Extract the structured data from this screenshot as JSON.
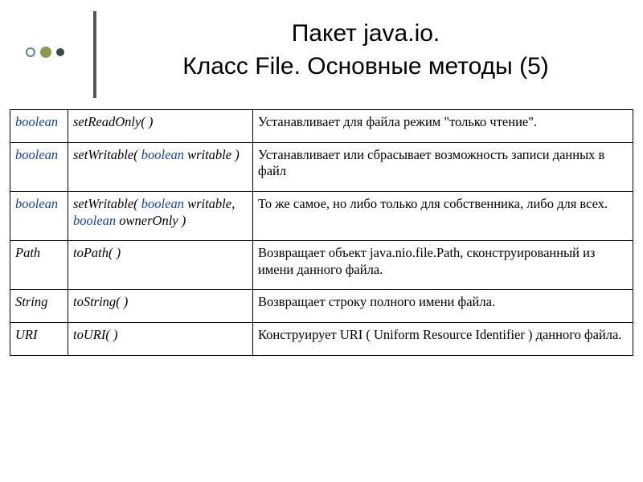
{
  "title_line1": "Пакет java.io.",
  "title_line2": "Класс File. Основные методы (5)",
  "rows": [
    {
      "ret_kw": "boolean",
      "sig_plain_1": "setReadOnly( )",
      "desc": "Устанавливает для файла режим \"только чтение\"."
    },
    {
      "ret_kw": "boolean",
      "sig_name": "setWritable( ",
      "sig_kw1": "boolean",
      "sig_after1": " writable )",
      "desc": "Устанавливает или сбрасывает возможность записи данных в файл"
    },
    {
      "ret_kw": "boolean",
      "sig_name": "setWritable( ",
      "sig_kw1": "boolean",
      "sig_after1": " writable, ",
      "sig_kw2": "boolean",
      "sig_after2": " ownerOnly )",
      "desc": "То же самое, но либо только для собственника, либо для всех."
    },
    {
      "ret_plain": "Path",
      "sig_plain_1": "toPath( )",
      "desc": "Возвращает объект java.nio.file.Path, сконструированный из имени данного файла."
    },
    {
      "ret_plain": "String",
      "sig_plain_1": "toString( )",
      "desc": "Возвращает строку полного имени файла."
    },
    {
      "ret_plain": "URI",
      "sig_plain_1": "toURI( )",
      "desc": "Конструирует URI ( Uniform Resource Identifier ) данного файла."
    }
  ],
  "chart_data": {
    "type": "table",
    "title": "Пакет java.io. Класс File. Основные методы (5)",
    "columns": [
      "Return type",
      "Method signature",
      "Description"
    ],
    "rows": [
      [
        "boolean",
        "setReadOnly( )",
        "Устанавливает для файла режим \"только чтение\"."
      ],
      [
        "boolean",
        "setWritable( boolean writable )",
        "Устанавливает или сбрасывает возможность записи данных в файл"
      ],
      [
        "boolean",
        "setWritable( boolean writable, boolean ownerOnly )",
        "То же самое, но либо только для собственника, либо для всех."
      ],
      [
        "Path",
        "toPath( )",
        "Возвращает объект java.nio.file.Path, сконструированный из имени данного файла."
      ],
      [
        "String",
        "toString( )",
        "Возвращает строку полного имени файла."
      ],
      [
        "URI",
        "toURI( )",
        "Конструирует URI ( Uniform Resource Identifier ) данного файла."
      ]
    ]
  }
}
